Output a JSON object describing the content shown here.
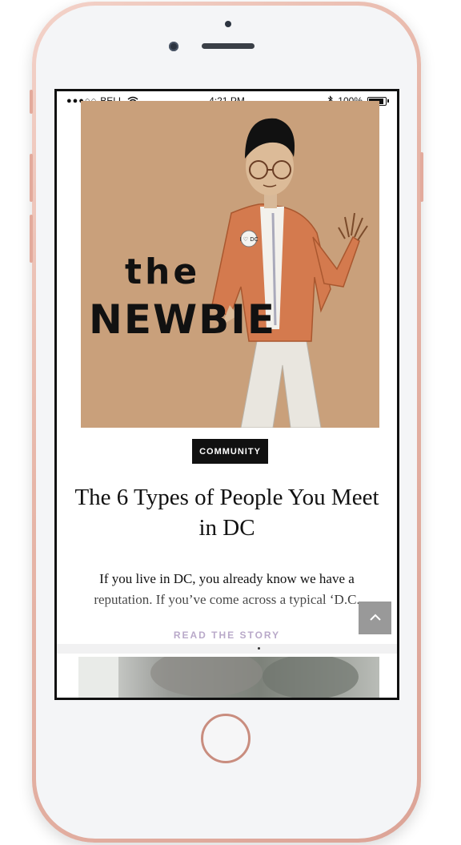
{
  "statusbar": {
    "signal_dots": "●●●○○",
    "carrier": "BELL",
    "time": "4:21 PM",
    "battery_percent": "100%"
  },
  "hero": {
    "art_text_top": "the",
    "art_text_bottom": "NEWBIE",
    "badge_text": "I ♡ DC"
  },
  "post": {
    "category": "COMMUNITY",
    "title": "The 6 Types of People You Meet in DC",
    "excerpt": "If you live in DC, you already know we have a reputation. If you’ve come across a typical ‘D.C.",
    "read_more": "READ THE STORY"
  },
  "icons": {
    "back_to_top": "chevron-up-icon",
    "wifi": "wifi-icon",
    "bluetooth": "bluetooth-icon",
    "battery": "battery-icon"
  },
  "colors": {
    "hero_bg": "#c9a07b",
    "tag_bg": "#111111",
    "read_more": "#b9a9c9",
    "back_to_top_bg": "#999999",
    "phone_frame": "#e7b6a8"
  }
}
